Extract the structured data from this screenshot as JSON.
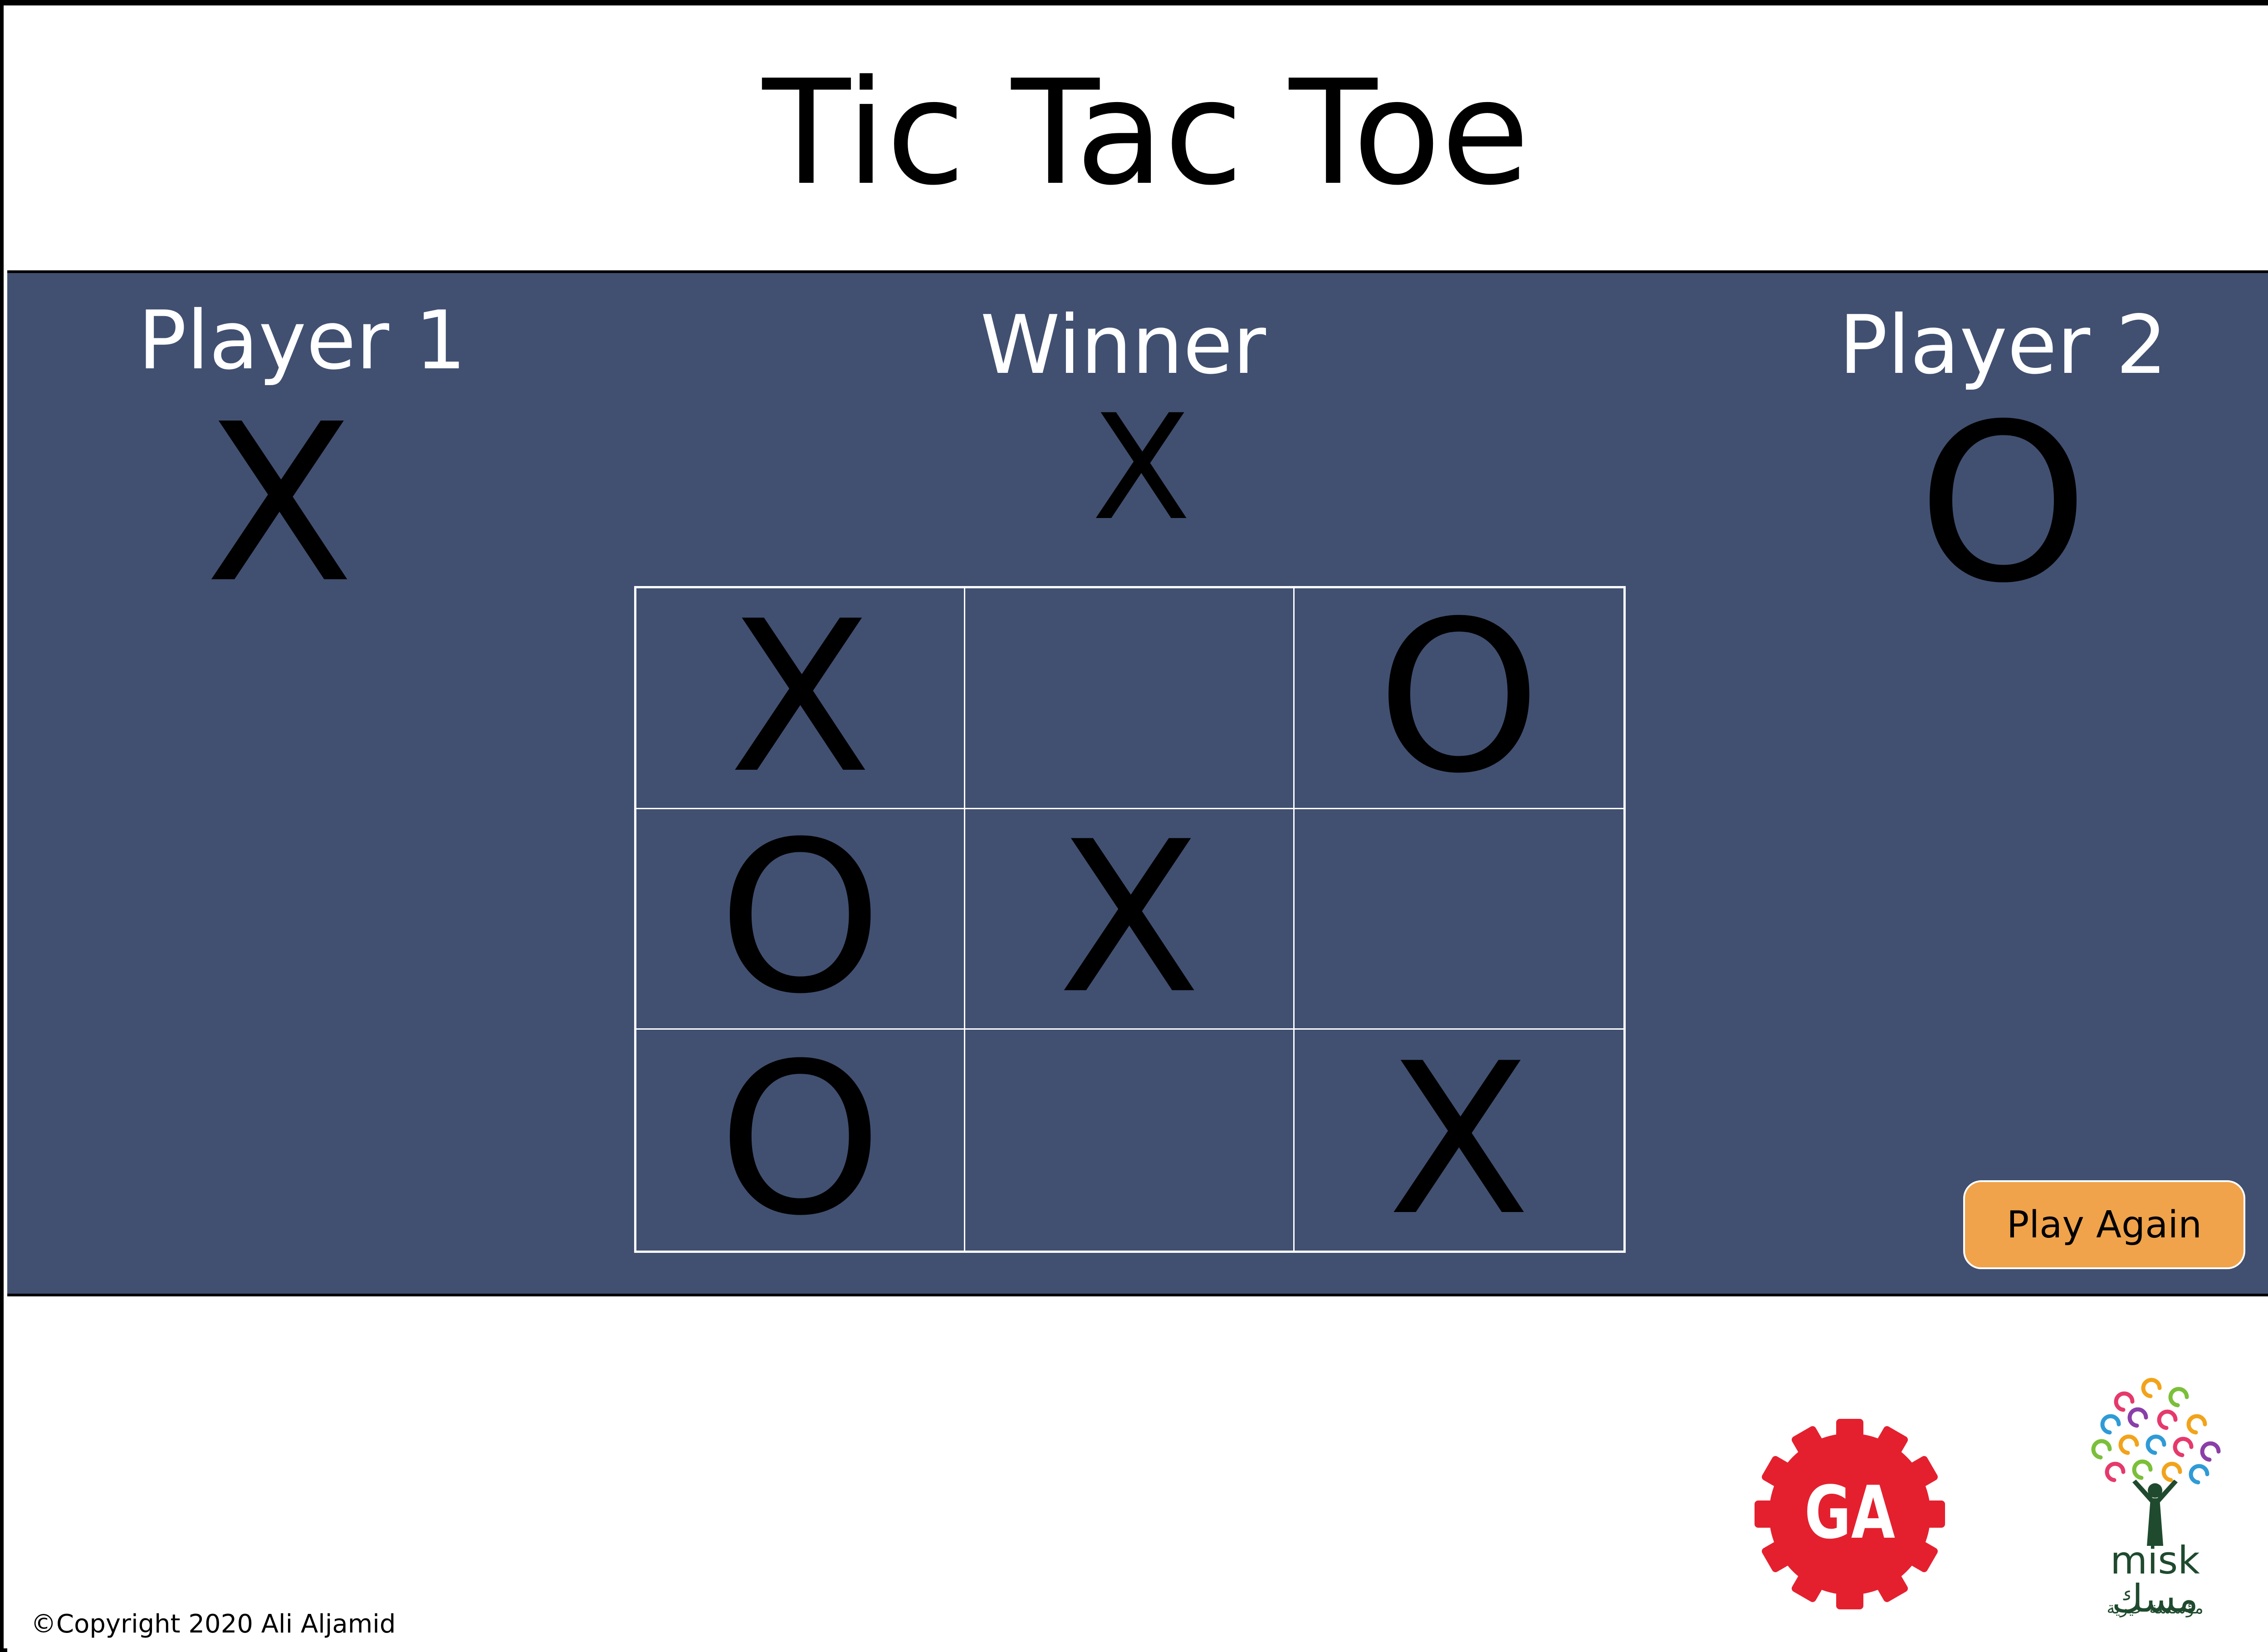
{
  "header": {
    "title": "Tic Tac Toe"
  },
  "scoreboard": {
    "player1": {
      "label": "Player 1",
      "mark": "X"
    },
    "winner": {
      "label": "Winner",
      "mark": "X"
    },
    "player2": {
      "label": "Player 2",
      "mark": "O"
    }
  },
  "board": {
    "cells": [
      [
        "X",
        "",
        "O"
      ],
      [
        "O",
        "X",
        ""
      ],
      [
        "O",
        "",
        "X"
      ]
    ]
  },
  "controls": {
    "play_again_label": "Play Again"
  },
  "footer": {
    "copyright": "©Copyright 2020 Ali Aljamid",
    "ga_logo_text": "GA",
    "misk_logo_text": "misk مسك",
    "misk_logo_subtext": "مؤسسة خيرية"
  },
  "colors": {
    "board_background": "#415071",
    "grid_lines": "#ffffff",
    "button_background": "#f0a34a",
    "ga_red": "#e4202f"
  }
}
